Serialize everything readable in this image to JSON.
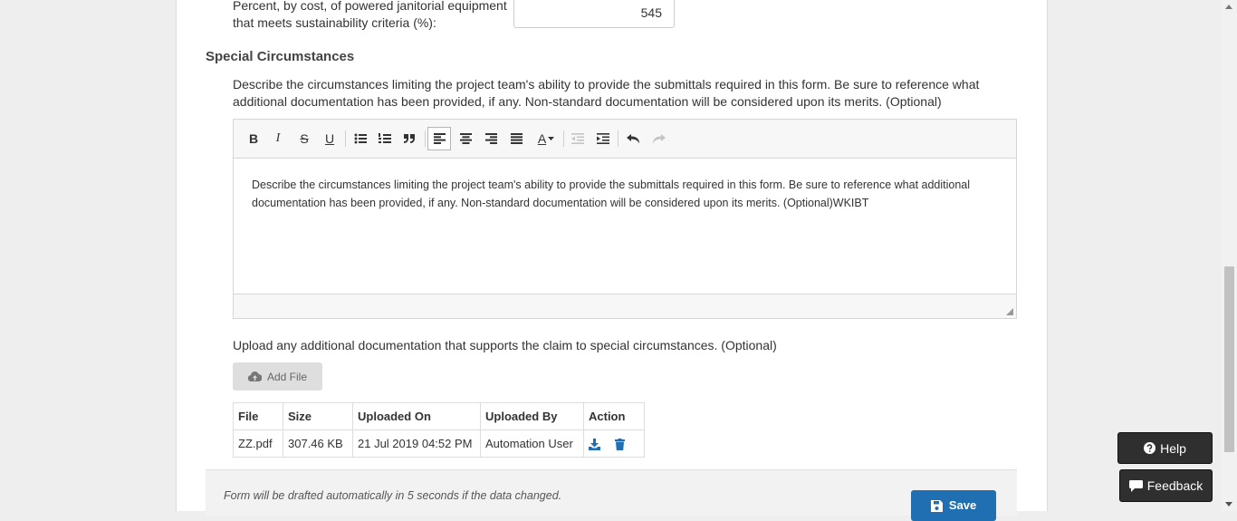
{
  "equipment": {
    "label": "Percent, by cost, of powered janitorial equipment that meets sustainability criteria (%):",
    "value": "545"
  },
  "special": {
    "title": "Special Circumstances",
    "description": "Describe the circumstances limiting the project team's ability to provide the submittals required in this form. Be sure to reference what additional documentation has been provided, if any. Non-standard documentation will be considered upon its merits. (Optional)",
    "editor_text": "Describe the circumstances limiting the project team's ability to provide the submittals required in this form. Be sure to reference what additional documentation has been provided, if any. Non-standard documentation will be considered upon its merits. (Optional)WKIBT",
    "toolbar": {
      "bold": "B",
      "italic": "I",
      "strike": "S",
      "underline": "U",
      "text_color": "A",
      "active_color": "#b5b5b5"
    }
  },
  "upload": {
    "label": "Upload any additional documentation that supports the claim to special circumstances. (Optional)",
    "add_file_label": "Add File"
  },
  "files_table": {
    "headers": [
      "File",
      "Size",
      "Uploaded On",
      "Uploaded By",
      "Action"
    ],
    "rows": [
      {
        "file": "ZZ.pdf",
        "size": "307.46 KB",
        "uploaded_on": "21 Jul 2019 04:52 PM",
        "uploaded_by": "Automation User"
      }
    ],
    "icon_color": "#1f6fb2"
  },
  "footer": {
    "draft_note": "Form will be drafted automatically in 5 seconds if the data changed.",
    "save_label": "Save"
  },
  "help": {
    "label": "Help"
  },
  "feedback": {
    "label": "Feedback"
  },
  "colors": {
    "primary": "#1f6fb2",
    "dark_button": "#2f2f2f"
  }
}
